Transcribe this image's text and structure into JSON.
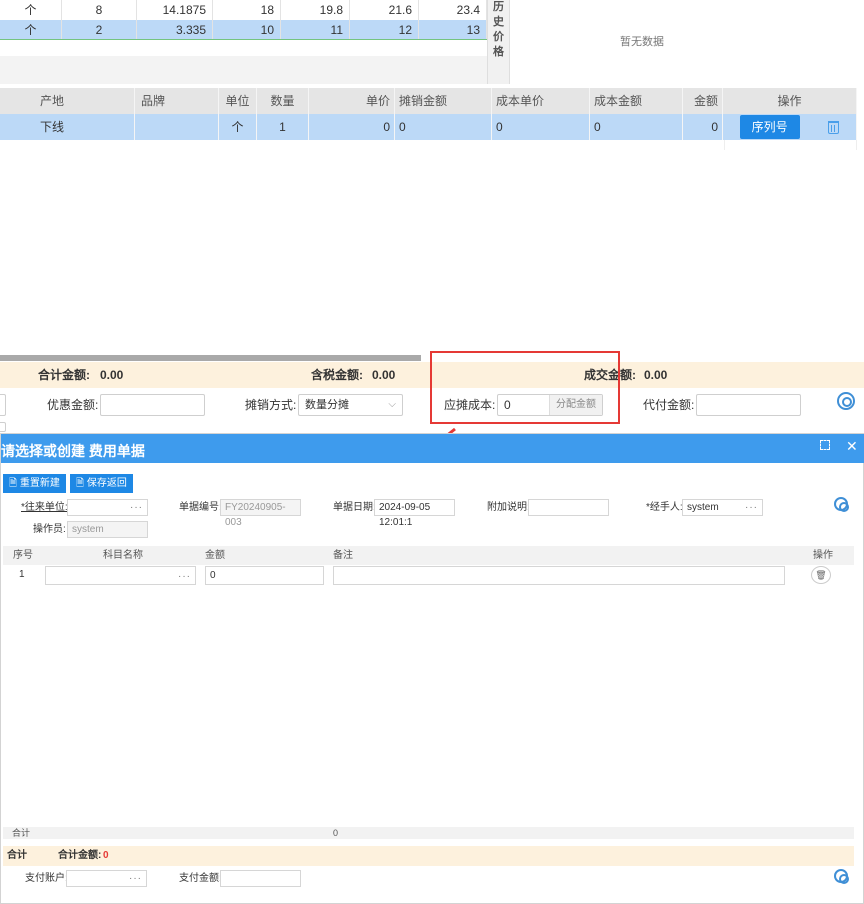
{
  "top_table": {
    "rows": [
      {
        "unit": "个",
        "qty": "8",
        "p1": "14.1875",
        "p2": "18",
        "p3": "19.8",
        "p4": "21.6",
        "p5": "23.4"
      },
      {
        "unit": "个",
        "qty": "2",
        "p1": "3.335",
        "p2": "10",
        "p3": "11",
        "p4": "12",
        "p5": "13"
      }
    ],
    "history_label": [
      "历",
      "史",
      "价",
      "格"
    ],
    "no_data": "暂无数据"
  },
  "detail_table": {
    "headers": {
      "origin": "产地",
      "brand": "品牌",
      "unit": "单位",
      "qty": "数量",
      "price": "单价",
      "amort_amount": "摊销金额",
      "cost_price": "成本单价",
      "cost_amount": "成本金额",
      "amount": "金额",
      "ops": "操作"
    },
    "row": {
      "origin": "下线",
      "brand": "",
      "unit": "个",
      "qty": "1",
      "price": "0",
      "amort_amount": "0",
      "cost_price": "0",
      "cost_amount": "0",
      "amount": "0",
      "serial_btn": "序列号"
    }
  },
  "totals": {
    "total_label": "合计金额:",
    "total": "0.00",
    "tax_label": "含税金额:",
    "tax": "0.00",
    "deal_label": "成交金额:",
    "deal": "0.00"
  },
  "form": {
    "discount_label": "优惠金额:",
    "amort_method_label": "摊销方式:",
    "amort_method_value": "数量分摊",
    "amort_cost_label": "应摊成本:",
    "amort_cost_value": "0",
    "alloc_btn": "分配金额",
    "agent_pay_label": "代付金额:"
  },
  "dialog": {
    "title": "请选择或创建 费用单据",
    "btn_reset": "重置新建",
    "btn_save": "保存返回",
    "partner_label": "*往来单位:",
    "docno_label": "单据编号:",
    "docno_value": "FY20240905-003",
    "date_label": "单据日期:",
    "date_value": "2024-09-05 12:01:1",
    "note_label": "附加说明:",
    "handler_label": "*经手人:",
    "handler_value": "system",
    "operator_label": "操作员:",
    "operator_value": "system",
    "grid_headers": {
      "seq": "序号",
      "subject": "科目名称",
      "amount": "金额",
      "remark": "备注",
      "ops": "操作"
    },
    "grid_row": {
      "seq": "1",
      "amount": "0"
    },
    "grid_footer": {
      "label": "合计",
      "amount": "0"
    },
    "sum_label": "合计",
    "sum_total_label": "合计金额:",
    "sum_total_value": "0",
    "pay_account_label": "支付账户:",
    "pay_amount_label": "支付金额:"
  },
  "colors": {
    "accent": "#1e88e5",
    "selected_row": "#bcd9f7",
    "totals_bg": "#fdf1dd",
    "highlight": "#e53935"
  }
}
